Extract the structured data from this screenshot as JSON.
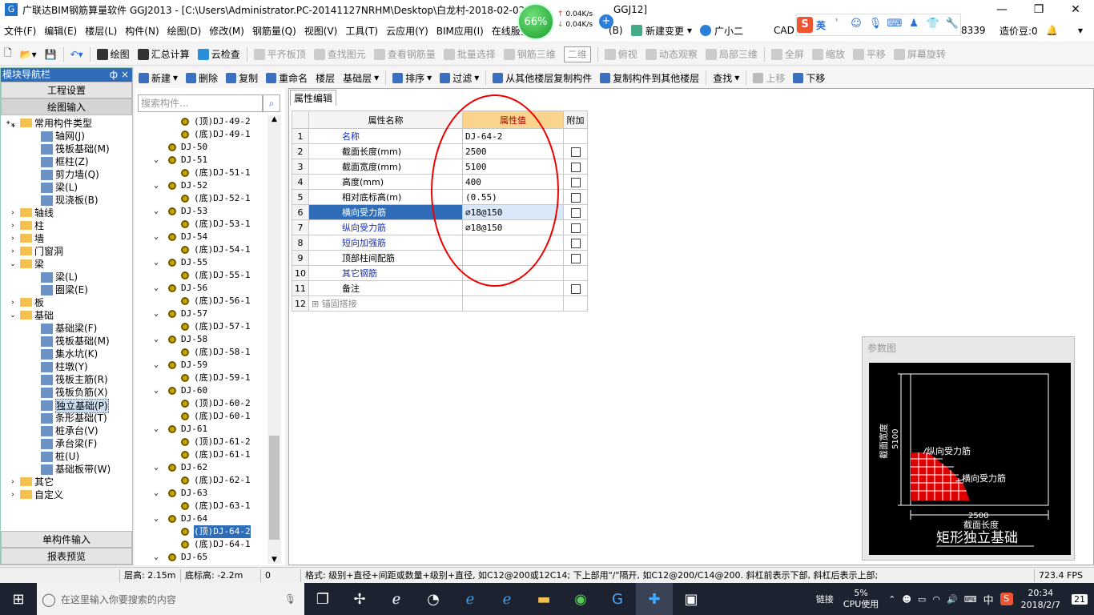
{
  "titlebar": {
    "title": "广联达BIM钢筋算量软件 GGJ2013 - [C:\\Users\\Administrator.PC-20141127NRHM\\Desktop\\白龙村-2018-02-02-",
    "title_tail": "GGJ12]"
  },
  "netwidget": {
    "percent": "66%",
    "up": "0.04K/s",
    "down": "0.04K/s"
  },
  "menu": [
    "文件(F)",
    "编辑(E)",
    "楼层(L)",
    "构件(N)",
    "绘图(D)",
    "修改(M)",
    "钢筋量(Q)",
    "视图(V)",
    "工具(T)",
    "云应用(Y)",
    "BIM应用(I)",
    "在线服务"
  ],
  "menu_right": {
    "b": "(B)",
    "change": "新建变更",
    "helper": "广小二",
    "cad": "CAD",
    "num": "8339",
    "cost": "造价豆:0"
  },
  "ime": {
    "s": "S",
    "lang": "英"
  },
  "toolbar1": [
    {
      "label": "绘图",
      "icon": "draw-icon",
      "dis": false
    },
    {
      "label": "汇总计算",
      "icon": "sigma-icon",
      "dis": false
    },
    {
      "label": "云检查",
      "icon": "cloud-check-icon",
      "dis": false
    },
    {
      "label": "平齐板顶",
      "icon": "align-icon",
      "dis": true
    },
    {
      "label": "查找图元",
      "icon": "find-icon",
      "dis": true
    },
    {
      "label": "查看钢筋量",
      "icon": "view-rebar-icon",
      "dis": true
    },
    {
      "label": "批量选择",
      "icon": "batch-icon",
      "dis": true
    },
    {
      "label": "钢筋三维",
      "icon": "rebar3d-icon",
      "dis": true
    },
    {
      "label": "二维",
      "icon": "",
      "dis": true
    },
    {
      "label": "俯视",
      "icon": "topview-icon",
      "dis": true
    },
    {
      "label": "动态观察",
      "icon": "orbit-icon",
      "dis": true
    },
    {
      "label": "局部三维",
      "icon": "local3d-icon",
      "dis": true
    },
    {
      "label": "全屏",
      "icon": "fullscreen-icon",
      "dis": true
    },
    {
      "label": "缩放",
      "icon": "zoom-icon",
      "dis": true
    },
    {
      "label": "平移",
      "icon": "pan-icon",
      "dis": true
    },
    {
      "label": "屏幕旋转",
      "icon": "rotate-icon",
      "dis": true
    }
  ],
  "leftnav": {
    "header": "模块导航栏",
    "btn_settings": "工程设置",
    "btn_draw": "绘图输入",
    "btn_single": "单构件输入",
    "btn_report": "报表预览",
    "tree": [
      {
        "indent": 0,
        "exp": "v",
        "type": "folder",
        "label": "常用构件类型"
      },
      {
        "indent": 1,
        "exp": "",
        "type": "comp",
        "label": "轴网(J)"
      },
      {
        "indent": 1,
        "exp": "",
        "type": "comp",
        "label": "筏板基础(M)"
      },
      {
        "indent": 1,
        "exp": "",
        "type": "comp",
        "label": "框柱(Z)"
      },
      {
        "indent": 1,
        "exp": "",
        "type": "comp",
        "label": "剪力墙(Q)"
      },
      {
        "indent": 1,
        "exp": "",
        "type": "comp",
        "label": "梁(L)"
      },
      {
        "indent": 1,
        "exp": "",
        "type": "comp",
        "label": "现浇板(B)"
      },
      {
        "indent": 0,
        "exp": ">",
        "type": "folder",
        "label": "轴线"
      },
      {
        "indent": 0,
        "exp": ">",
        "type": "folder",
        "label": "柱"
      },
      {
        "indent": 0,
        "exp": ">",
        "type": "folder",
        "label": "墙"
      },
      {
        "indent": 0,
        "exp": ">",
        "type": "folder",
        "label": "门窗洞"
      },
      {
        "indent": 0,
        "exp": "v",
        "type": "folder",
        "label": "梁"
      },
      {
        "indent": 1,
        "exp": "",
        "type": "comp",
        "label": "梁(L)"
      },
      {
        "indent": 1,
        "exp": "",
        "type": "comp",
        "label": "圈梁(E)"
      },
      {
        "indent": 0,
        "exp": ">",
        "type": "folder",
        "label": "板"
      },
      {
        "indent": 0,
        "exp": "v",
        "type": "folder",
        "label": "基础"
      },
      {
        "indent": 1,
        "exp": "",
        "type": "comp",
        "label": "基础梁(F)"
      },
      {
        "indent": 1,
        "exp": "",
        "type": "comp",
        "label": "筏板基础(M)"
      },
      {
        "indent": 1,
        "exp": "",
        "type": "comp",
        "label": "集水坑(K)"
      },
      {
        "indent": 1,
        "exp": "",
        "type": "comp",
        "label": "柱墩(Y)"
      },
      {
        "indent": 1,
        "exp": "",
        "type": "comp",
        "label": "筏板主筋(R)"
      },
      {
        "indent": 1,
        "exp": "",
        "type": "comp",
        "label": "筏板负筋(X)"
      },
      {
        "indent": 1,
        "exp": "",
        "type": "comp",
        "label": "独立基础(P)",
        "sel": true
      },
      {
        "indent": 1,
        "exp": "",
        "type": "comp",
        "label": "条形基础(T)"
      },
      {
        "indent": 1,
        "exp": "",
        "type": "comp",
        "label": "桩承台(V)"
      },
      {
        "indent": 1,
        "exp": "",
        "type": "comp",
        "label": "承台梁(F)"
      },
      {
        "indent": 1,
        "exp": "",
        "type": "comp",
        "label": "桩(U)"
      },
      {
        "indent": 1,
        "exp": "",
        "type": "comp",
        "label": "基础板带(W)"
      },
      {
        "indent": 0,
        "exp": ">",
        "type": "folder",
        "label": "其它"
      },
      {
        "indent": 0,
        "exp": ">",
        "type": "folder",
        "label": "自定义"
      }
    ]
  },
  "comptoolbar": [
    {
      "label": "新建",
      "icon": "new-icon"
    },
    {
      "label": "删除",
      "icon": "delete-icon"
    },
    {
      "label": "复制",
      "icon": "copy-icon"
    },
    {
      "label": "重命名",
      "icon": "rename-icon"
    },
    {
      "label": "楼层",
      "icon": ""
    },
    {
      "label": "基础层",
      "icon": ""
    },
    {
      "label": "排序",
      "icon": "sort-icon"
    },
    {
      "label": "过滤",
      "icon": "filter-icon"
    },
    {
      "label": "从其他楼层复制构件",
      "icon": "copy-from-icon"
    },
    {
      "label": "复制构件到其他楼层",
      "icon": "copy-to-icon"
    },
    {
      "label": "查找",
      "icon": ""
    },
    {
      "label": "上移",
      "icon": "up-icon"
    },
    {
      "label": "下移",
      "icon": "down-icon"
    }
  ],
  "search_placeholder": "搜索构件...",
  "comptree": [
    {
      "indent": 2,
      "exp": "",
      "label": "(顶)DJ-49-2"
    },
    {
      "indent": 2,
      "exp": "",
      "label": "(底)DJ-49-1"
    },
    {
      "indent": 1,
      "exp": "",
      "label": "DJ-50"
    },
    {
      "indent": 1,
      "exp": "v",
      "label": "DJ-51"
    },
    {
      "indent": 2,
      "exp": "",
      "label": "(底)DJ-51-1"
    },
    {
      "indent": 1,
      "exp": "v",
      "label": "DJ-52"
    },
    {
      "indent": 2,
      "exp": "",
      "label": "(底)DJ-52-1"
    },
    {
      "indent": 1,
      "exp": "v",
      "label": "DJ-53"
    },
    {
      "indent": 2,
      "exp": "",
      "label": "(底)DJ-53-1"
    },
    {
      "indent": 1,
      "exp": "v",
      "label": "DJ-54"
    },
    {
      "indent": 2,
      "exp": "",
      "label": "(底)DJ-54-1"
    },
    {
      "indent": 1,
      "exp": "v",
      "label": "DJ-55"
    },
    {
      "indent": 2,
      "exp": "",
      "label": "(底)DJ-55-1"
    },
    {
      "indent": 1,
      "exp": "v",
      "label": "DJ-56"
    },
    {
      "indent": 2,
      "exp": "",
      "label": "(底)DJ-56-1"
    },
    {
      "indent": 1,
      "exp": "v",
      "label": "DJ-57"
    },
    {
      "indent": 2,
      "exp": "",
      "label": "(底)DJ-57-1"
    },
    {
      "indent": 1,
      "exp": "v",
      "label": "DJ-58"
    },
    {
      "indent": 2,
      "exp": "",
      "label": "(底)DJ-58-1"
    },
    {
      "indent": 1,
      "exp": "v",
      "label": "DJ-59"
    },
    {
      "indent": 2,
      "exp": "",
      "label": "(底)DJ-59-1"
    },
    {
      "indent": 1,
      "exp": "v",
      "label": "DJ-60"
    },
    {
      "indent": 2,
      "exp": "",
      "label": "(顶)DJ-60-2"
    },
    {
      "indent": 2,
      "exp": "",
      "label": "(底)DJ-60-1"
    },
    {
      "indent": 1,
      "exp": "v",
      "label": "DJ-61"
    },
    {
      "indent": 2,
      "exp": "",
      "label": "(顶)DJ-61-2"
    },
    {
      "indent": 2,
      "exp": "",
      "label": "(底)DJ-61-1"
    },
    {
      "indent": 1,
      "exp": "v",
      "label": "DJ-62"
    },
    {
      "indent": 2,
      "exp": "",
      "label": "(底)DJ-62-1"
    },
    {
      "indent": 1,
      "exp": "v",
      "label": "DJ-63"
    },
    {
      "indent": 2,
      "exp": "",
      "label": "(底)DJ-63-1"
    },
    {
      "indent": 1,
      "exp": "v",
      "label": "DJ-64"
    },
    {
      "indent": 2,
      "exp": "",
      "label": "(顶)DJ-64-2",
      "sel": true
    },
    {
      "indent": 2,
      "exp": "",
      "label": "(底)DJ-64-1"
    },
    {
      "indent": 1,
      "exp": "v",
      "label": "DJ-65"
    }
  ],
  "props": {
    "tab": "属性编辑",
    "headers": {
      "name": "属性名称",
      "value": "属性值",
      "extra": "附加"
    },
    "rows": [
      {
        "n": "1",
        "name": "名称",
        "value": "DJ-64-2",
        "style": "blue",
        "cb": false
      },
      {
        "n": "2",
        "name": "截面长度(mm)",
        "value": "2500",
        "style": "",
        "cb": true
      },
      {
        "n": "3",
        "name": "截面宽度(mm)",
        "value": "5100",
        "style": "",
        "cb": true
      },
      {
        "n": "4",
        "name": "高度(mm)",
        "value": "400",
        "style": "",
        "cb": true
      },
      {
        "n": "5",
        "name": "相对底标高(m)",
        "value": "(0.55)",
        "style": "",
        "cb": true
      },
      {
        "n": "6",
        "name": "横向受力筋",
        "value": "⌀18@150",
        "style": "sel",
        "cb": true
      },
      {
        "n": "7",
        "name": "纵向受力筋",
        "value": "⌀18@150",
        "style": "blue",
        "cb": true
      },
      {
        "n": "8",
        "name": "短向加强筋",
        "value": "",
        "style": "blue",
        "cb": true
      },
      {
        "n": "9",
        "name": "顶部柱间配筋",
        "value": "",
        "style": "",
        "cb": true
      },
      {
        "n": "10",
        "name": "其它钢筋",
        "value": "",
        "style": "blue",
        "cb": false
      },
      {
        "n": "11",
        "name": "备注",
        "value": "",
        "style": "",
        "cb": true
      },
      {
        "n": "12",
        "name": "锚固搭接",
        "value": "",
        "style": "gray",
        "cb": false,
        "plus": true
      }
    ]
  },
  "param": {
    "title": "参数图",
    "width_label": "截面宽度",
    "width_val": "5100",
    "long_label": "纵向受力筋",
    "trans_label": "横向受力筋",
    "len_val": "2500",
    "len_label": "截面长度",
    "caption": "矩形独立基础"
  },
  "status": {
    "floor_h": "层高: 2.15m",
    "bottom": "底标高: -2.2m",
    "zero": "0",
    "hint": "格式: 级别+直径+间距或数量+级别+直径, 如C12@200或12C14; 下上部用\"/\"隔开, 如C12@200/C14@200. 斜杠前表示下部, 斜杠后表示上部;",
    "fps": "723.4 FPS"
  },
  "taskbar": {
    "search": "在这里输入你要搜索的内容",
    "cpu_pct": "5%",
    "cpu_label": "CPU使用",
    "link": "链接",
    "lang": "中",
    "time": "20:34",
    "date": "2018/2/7",
    "notif": "21"
  }
}
